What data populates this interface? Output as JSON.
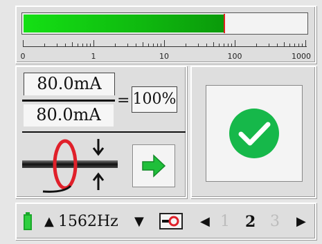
{
  "bargraph": {
    "level_fraction": 0.71,
    "scale_labels": [
      "0",
      "1",
      "10",
      "100",
      "1000"
    ]
  },
  "measurement": {
    "measured": "80.0mA",
    "equals": "=",
    "reference": "80.0mA",
    "ratio": "100%"
  },
  "result": {
    "status": "pass",
    "icon": "check-circle-icon"
  },
  "footer": {
    "freq_up": "▲",
    "frequency": "1562Hz",
    "freq_down": "▼",
    "page_prev": "◀",
    "pages": [
      "1",
      "2",
      "3"
    ],
    "current_page": "2",
    "page_next": "▶"
  },
  "colors": {
    "bar_fill": "#14e014",
    "marker": "#e02020",
    "pass": "#16b84a",
    "clamp": "#e0202a",
    "battery": "#1aa82a"
  }
}
